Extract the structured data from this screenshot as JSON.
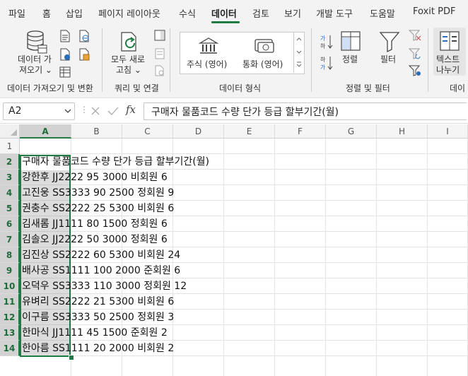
{
  "tabs": [
    {
      "label": "파일"
    },
    {
      "label": "홈"
    },
    {
      "label": "삽입"
    },
    {
      "label": "페이지 레이아웃"
    },
    {
      "label": "수식"
    },
    {
      "label": "데이터"
    },
    {
      "label": "검토"
    },
    {
      "label": "보기"
    },
    {
      "label": "개발 도구"
    },
    {
      "label": "도움말"
    },
    {
      "label": "Foxit PDF"
    }
  ],
  "ribbon": {
    "get_data": {
      "line1": "데이터 가",
      "line2": "져오기 ⌄"
    },
    "refresh_all": {
      "line1": "모두 새로",
      "line2": "고침 ⌄"
    },
    "stocks_label": "주식 (영어)",
    "currencies_label": "통화 (영어)",
    "sort_label": "정렬",
    "filter_label": "필터",
    "text_to_columns": {
      "line1": "텍스트",
      "line2": "나누기"
    },
    "groups": {
      "get_transform": "데이터 가져오기 및 변환",
      "queries": "쿼리 및 연결",
      "data_types": "데이터 형식",
      "sort_filter": "정렬 및 필터",
      "data_tools": "데이"
    }
  },
  "formula_bar": {
    "name_box": "A2",
    "fx": "fx",
    "formula": "구매자 물품코드 수량 단가 등급 할부기간(월)"
  },
  "grid": {
    "columns": [
      "A",
      "B",
      "C",
      "D",
      "E",
      "F",
      "G",
      "H",
      "I"
    ],
    "rows": [
      "1",
      "2",
      "3",
      "4",
      "5",
      "6",
      "7",
      "8",
      "9",
      "10",
      "11",
      "12",
      "13",
      "14"
    ],
    "cells": [
      "",
      "구매자 물품코드 수량 단가 등급 할부기간(월)",
      "강한후 JJ2222 95 3000 비회원 6",
      "고진웅 SS3333 90 2500 정회원 9",
      "권충수 SS2222 25 5300 비회원 6",
      "김새롬 JJ1111 80 1500 정회원 6",
      "김솔오 JJ2222 50 3000 정회원 6",
      "김진상 SS2222 60 5300 비회원 24",
      "배사공 SS1111 100 2000 준회원 6",
      "오덕우 SS3333 110 3000 정회원 12",
      "유벼리 SS2222 21 5300 비회원 6",
      "이구름 SS3333 50 2500 정회원 3",
      "한마식 JJ1111 45 1500 준회원 2",
      "한아름 SS1111 20 2000 비회원 2"
    ]
  },
  "colors": {
    "accent": "#1f7a44",
    "ribbon_bg": "#f3f3f3"
  }
}
